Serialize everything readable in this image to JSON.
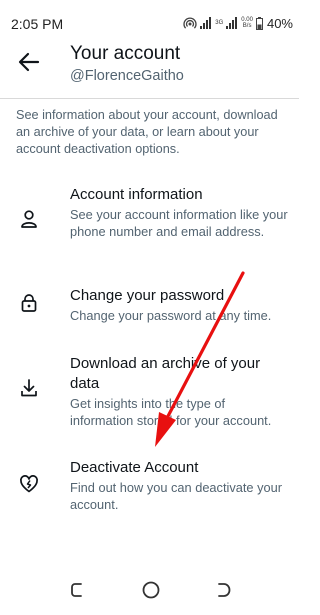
{
  "status_bar": {
    "time": "2:05 PM",
    "network_label_top": "3G",
    "data_rate_top": "0.00",
    "data_rate_bottom": "B/s",
    "battery": "40%"
  },
  "header": {
    "title": "Your account",
    "handle": "@FlorenceGaitho"
  },
  "intro": "See information about your account, download an archive of your data, or learn about your account deactivation options.",
  "items": [
    {
      "title": "Account information",
      "description": "See your account information like your phone number and email address.",
      "icon": "person-icon"
    },
    {
      "title": "Change your password",
      "description": "Change your password at any time.",
      "icon": "lock-icon"
    },
    {
      "title": "Download an archive of your data",
      "description": "Get insights into the type of information stored for your account.",
      "icon": "download-icon"
    },
    {
      "title": "Deactivate Account",
      "description": "Find out how you can deactivate your account.",
      "icon": "broken-heart-icon"
    }
  ],
  "colors": {
    "primary_text": "#0f1419",
    "secondary_text": "#536471",
    "annotation_arrow": "#e81010"
  }
}
